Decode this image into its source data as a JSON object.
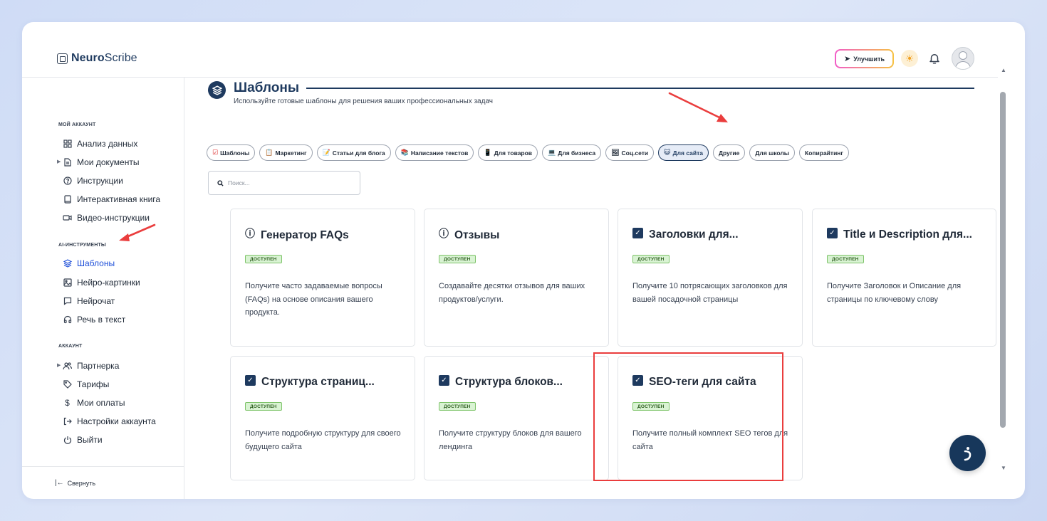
{
  "app": {
    "logo_bold": "Neuro",
    "logo_light": "Scribe"
  },
  "header": {
    "upgrade_label": "Улучшить",
    "icons": [
      "rocket-icon",
      "sun-icon",
      "bell-icon",
      "avatar"
    ]
  },
  "sidebar": {
    "sections": [
      {
        "title": "МОЙ АККАУНТ",
        "items": [
          {
            "label": "Анализ данных",
            "icon": "grid-icon"
          },
          {
            "label": "Мои документы",
            "icon": "document-icon"
          },
          {
            "label": "Инструкции",
            "icon": "help-icon"
          },
          {
            "label": "Интерактивная книга",
            "icon": "book-icon"
          },
          {
            "label": "Видео-инструкции",
            "icon": "video-icon"
          }
        ]
      },
      {
        "title": "AI-ИНСТРУМЕНТЫ",
        "items": [
          {
            "label": "Шаблоны",
            "icon": "layers-icon",
            "active": true
          },
          {
            "label": "Нейро-картинки",
            "icon": "image-icon"
          },
          {
            "label": "Нейрочат",
            "icon": "chat-icon"
          },
          {
            "label": "Речь в текст",
            "icon": "headphones-icon"
          }
        ]
      },
      {
        "title": "АККАУНТ",
        "items": [
          {
            "label": "Партнерка",
            "icon": "users-icon"
          },
          {
            "label": "Тарифы",
            "icon": "tag-icon"
          },
          {
            "label": "Мои оплаты",
            "icon": "dollar-icon"
          },
          {
            "label": "Настройки аккаунта",
            "icon": "login-icon"
          },
          {
            "label": "Выйти",
            "icon": "power-icon"
          }
        ]
      }
    ],
    "collapse_label": "Свернуть"
  },
  "main": {
    "title": "Шаблоны",
    "subtitle": "Используйте готовые шаблоны для решения ваших профессиональных задач",
    "chips": [
      {
        "label": "Шаблоны",
        "emoji": "☑"
      },
      {
        "label": "Маркетинг",
        "emoji": "📋"
      },
      {
        "label": "Статьи для блога",
        "emoji": "📝"
      },
      {
        "label": "Написание текстов",
        "emoji": "📚"
      },
      {
        "label": "Для товаров",
        "emoji": "📱"
      },
      {
        "label": "Для бизнеса",
        "emoji": "💻"
      },
      {
        "label": "Соц.сети",
        "emoji": "🖼"
      },
      {
        "label": "Для сайта",
        "emoji": "😺",
        "active": true
      },
      {
        "label": "Другие",
        "emoji": ""
      },
      {
        "label": "Для школы",
        "emoji": ""
      },
      {
        "label": "Копирайтинг",
        "emoji": ""
      }
    ],
    "search_placeholder": "Поиск...",
    "badge_label": "ДОСТУПЕН",
    "cards": [
      {
        "title": "Генератор FAQs",
        "icon": "info-icon",
        "desc": "Получите часто задаваемые вопросы (FAQs) на основе описания вашего продукта."
      },
      {
        "title": "Отзывы",
        "icon": "info-icon",
        "desc": "Создавайте десятки отзывов для ваших продуктов/услуги."
      },
      {
        "title": "Заголовки для...",
        "icon": "check-icon",
        "desc": "Получите 10 потрясающих заголовков для вашей посадочной страницы"
      },
      {
        "title": "Title и Description для...",
        "icon": "check-icon",
        "desc": "Получите Заголовок и Описание для страницы по ключевому слову"
      },
      {
        "title": "Структура страниц...",
        "icon": "check-icon",
        "desc": "Получите подробную структуру для своего будущего сайта"
      },
      {
        "title": "Структура блоков...",
        "icon": "check-icon",
        "desc": "Получите структуру блоков для вашего лендинга"
      },
      {
        "title": "SEO-теги для сайта",
        "icon": "check-icon",
        "desc": "Получите полный комплект SEO тегов для сайта"
      }
    ]
  },
  "colors": {
    "accent": "#1e3a5f",
    "link_active": "#1d4ed8",
    "highlight": "#ea3d3d",
    "badge_bg": "#d9f3d3"
  }
}
